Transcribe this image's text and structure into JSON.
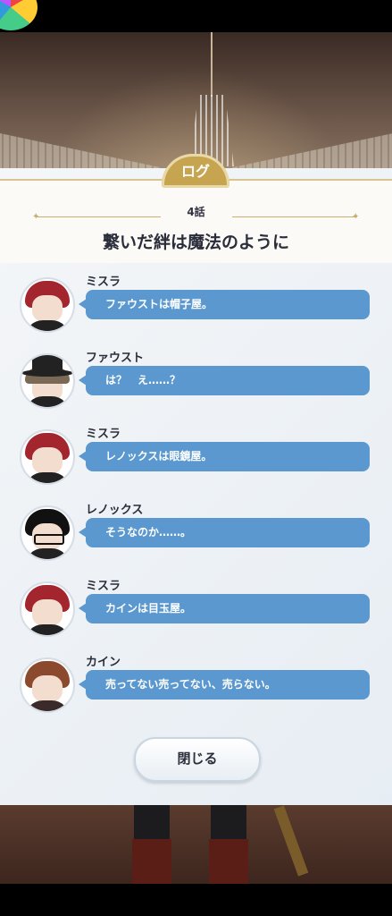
{
  "log_tab": "ログ",
  "episode": {
    "number": "4話",
    "title": "繋いだ絆は魔法のように"
  },
  "entries": [
    {
      "speaker": "ミスラ",
      "text": "ファウストは帽子屋。",
      "avatar": "mithra-portrait"
    },
    {
      "speaker": "ファウスト",
      "text": "は？　え……？",
      "avatar": "faust-portrait"
    },
    {
      "speaker": "ミスラ",
      "text": "レノックスは眼鏡屋。",
      "avatar": "mithra-portrait"
    },
    {
      "speaker": "レノックス",
      "text": "そうなのか……。",
      "avatar": "lennox-portrait"
    },
    {
      "speaker": "ミスラ",
      "text": "カインは目玉屋。",
      "avatar": "mithra-portrait"
    },
    {
      "speaker": "カイン",
      "text": "売ってない売ってない、売らない。",
      "avatar": "cain-portrait"
    }
  ],
  "close_label": "閉じる",
  "colors": {
    "bubble": "#5a98cf",
    "tab": "#c7a450",
    "accent_gold": "#c9b070"
  }
}
